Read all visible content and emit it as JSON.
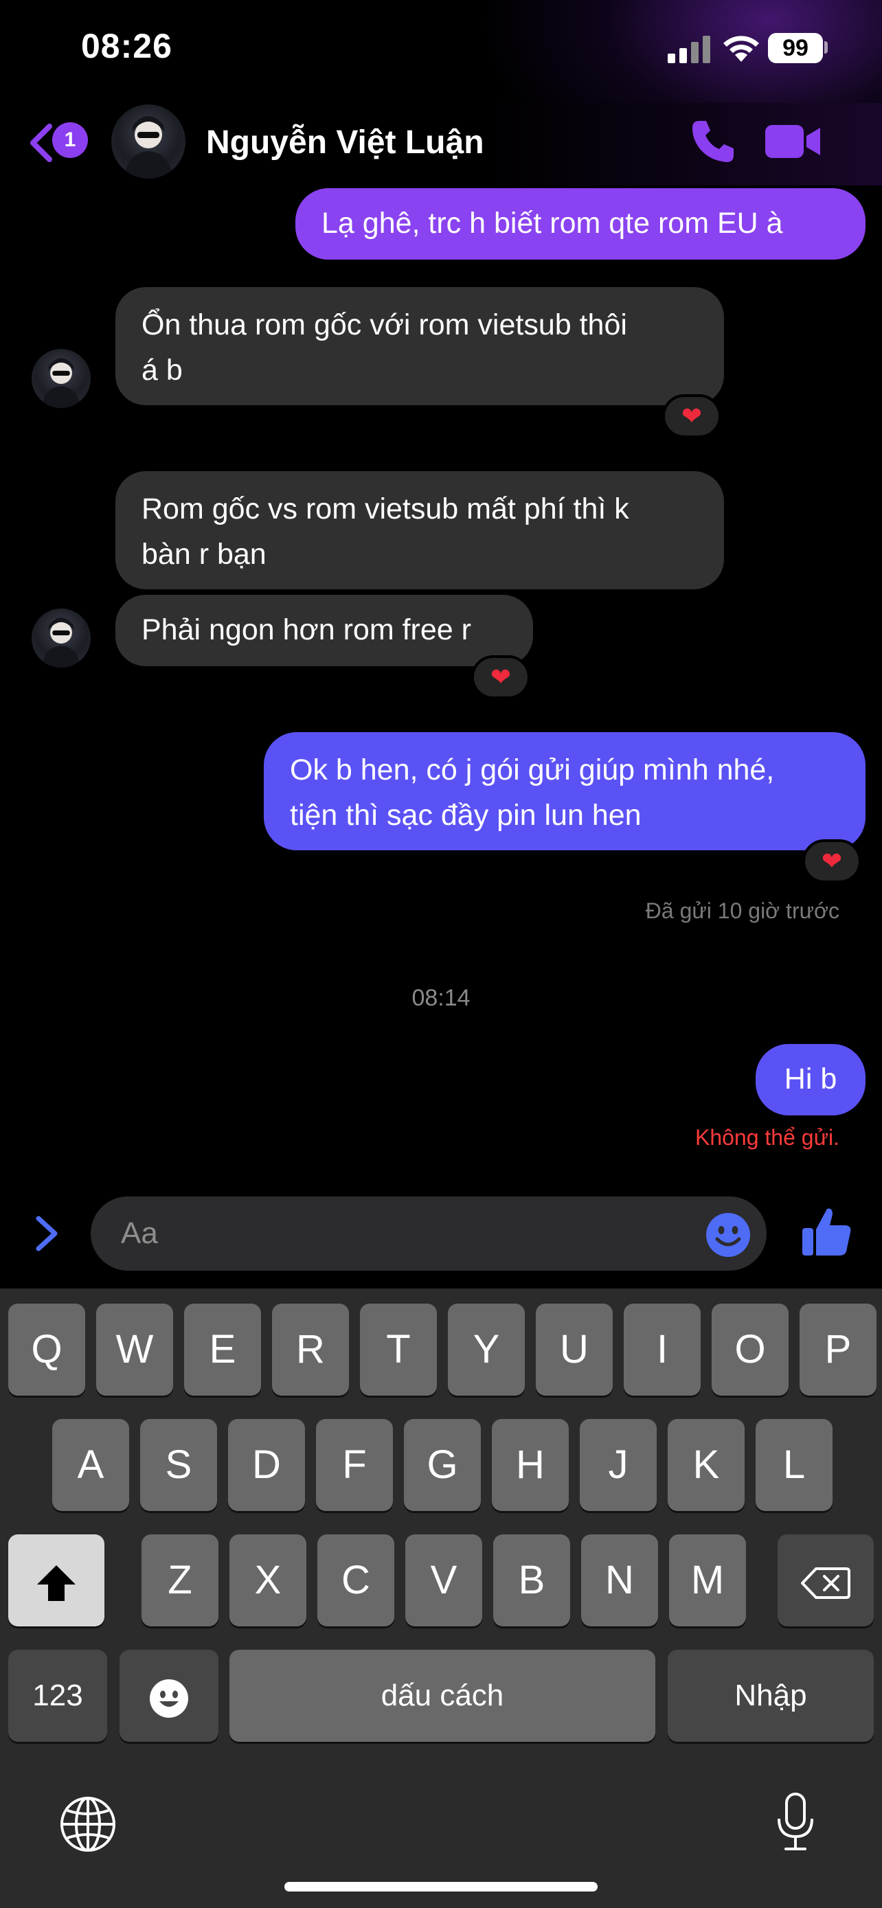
{
  "status_bar": {
    "time": "08:26",
    "battery": "99"
  },
  "header": {
    "back_badge": "1",
    "contact_name": "Nguyễn Việt Luận"
  },
  "messages": [
    {
      "side": "out",
      "text": "Lạ ghê, trc h biết rom qte rom EU à"
    },
    {
      "side": "in",
      "line1": "Ổn thua rom gốc với rom vietsub thôi",
      "line2": "á b",
      "reaction": "❤"
    },
    {
      "side": "in",
      "line1": "Rom gốc vs rom vietsub mất phí thì k",
      "line2": "bàn r bạn"
    },
    {
      "side": "in",
      "text": "Phải ngon hơn rom free r",
      "reaction": "❤"
    },
    {
      "side": "out",
      "line1": "Ok b hen, có j gói gửi giúp mình nhé,",
      "line2": "tiện thì sạc đầy pin lun hen",
      "reaction": "❤"
    },
    {
      "side": "out",
      "text": "Hi b"
    }
  ],
  "sent_status": "Đã gửi 10 giờ trước",
  "time_separator": "08:14",
  "failed_status": "Không thể gửi.",
  "composer": {
    "placeholder": "Aa"
  },
  "keyboard": {
    "row1": [
      "Q",
      "W",
      "E",
      "R",
      "T",
      "Y",
      "U",
      "I",
      "O",
      "P"
    ],
    "row2": [
      "A",
      "S",
      "D",
      "F",
      "G",
      "H",
      "J",
      "K",
      "L"
    ],
    "row3": [
      "Z",
      "X",
      "C",
      "V",
      "B",
      "N",
      "M"
    ],
    "numbers_label": "123",
    "space_label": "dấu cách",
    "return_label": "Nhập"
  },
  "colors": {
    "accent": "#8a43f0",
    "outgoing_blue": "#5b52f5",
    "incoming_bg": "#303030",
    "error": "#ff3b3b"
  }
}
